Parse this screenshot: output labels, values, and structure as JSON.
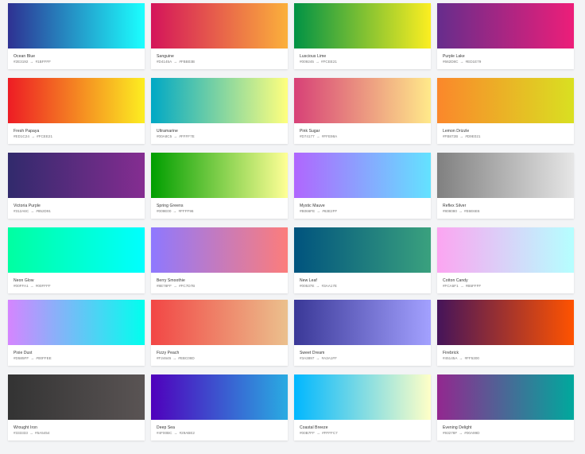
{
  "gradients": [
    {
      "name": "Ocean Blue",
      "from": "#2E3192",
      "to": "#1BFFFF"
    },
    {
      "name": "Sanguine",
      "from": "#D4145A",
      "to": "#FBB03B"
    },
    {
      "name": "Luscious Lime",
      "from": "#009245",
      "to": "#FCEE21"
    },
    {
      "name": "Purple Lake",
      "from": "#662D8C",
      "to": "#ED1E79"
    },
    {
      "name": "Fresh Papaya",
      "from": "#ED1C24",
      "to": "#FCEE21"
    },
    {
      "name": "Ultramarine",
      "from": "#00A8C5",
      "to": "#FFFF7E"
    },
    {
      "name": "Pink Sugar",
      "from": "#D74177",
      "to": "#FFE98A"
    },
    {
      "name": "Lemon Drizzle",
      "from": "#FB872B",
      "to": "#D9E021"
    },
    {
      "name": "Victoria Purple",
      "from": "#312A6C",
      "to": "#852D91"
    },
    {
      "name": "Spring Greens",
      "from": "#009E00",
      "to": "#FFFF96"
    },
    {
      "name": "Mystic Mauve",
      "from": "#B066FE",
      "to": "#63E2FF"
    },
    {
      "name": "Reflex Silver",
      "from": "#808080",
      "to": "#E6E6E6"
    },
    {
      "name": "Neon Glow",
      "from": "#00FFA1",
      "to": "#00FFFF"
    },
    {
      "name": "Berry Smoothie",
      "from": "#8E78FF",
      "to": "#FC7D7B"
    },
    {
      "name": "New Leaf",
      "from": "#00537E",
      "to": "#3AA17E"
    },
    {
      "name": "Cotton Candy",
      "from": "#FCA5F1",
      "to": "#B5FFFF"
    },
    {
      "name": "Pixie Dust",
      "from": "#D585FF",
      "to": "#00FFEE"
    },
    {
      "name": "Fizzy Peach",
      "from": "#F24645",
      "to": "#EBC08D"
    },
    {
      "name": "Sweet Dream",
      "from": "#3A3897",
      "to": "#A3A1FF"
    },
    {
      "name": "Firebrick",
      "from": "#45145A",
      "to": "#FF5300"
    },
    {
      "name": "Wrought Iron",
      "from": "#333333",
      "to": "#5A5454"
    },
    {
      "name": "Deep Sea",
      "from": "#4F00BC",
      "to": "#29ABE2"
    },
    {
      "name": "Coastal Breeze",
      "from": "#00B7FF",
      "to": "#FFFFC7"
    },
    {
      "name": "Evening Delight",
      "from": "#93278F",
      "to": "#00A99D"
    }
  ]
}
